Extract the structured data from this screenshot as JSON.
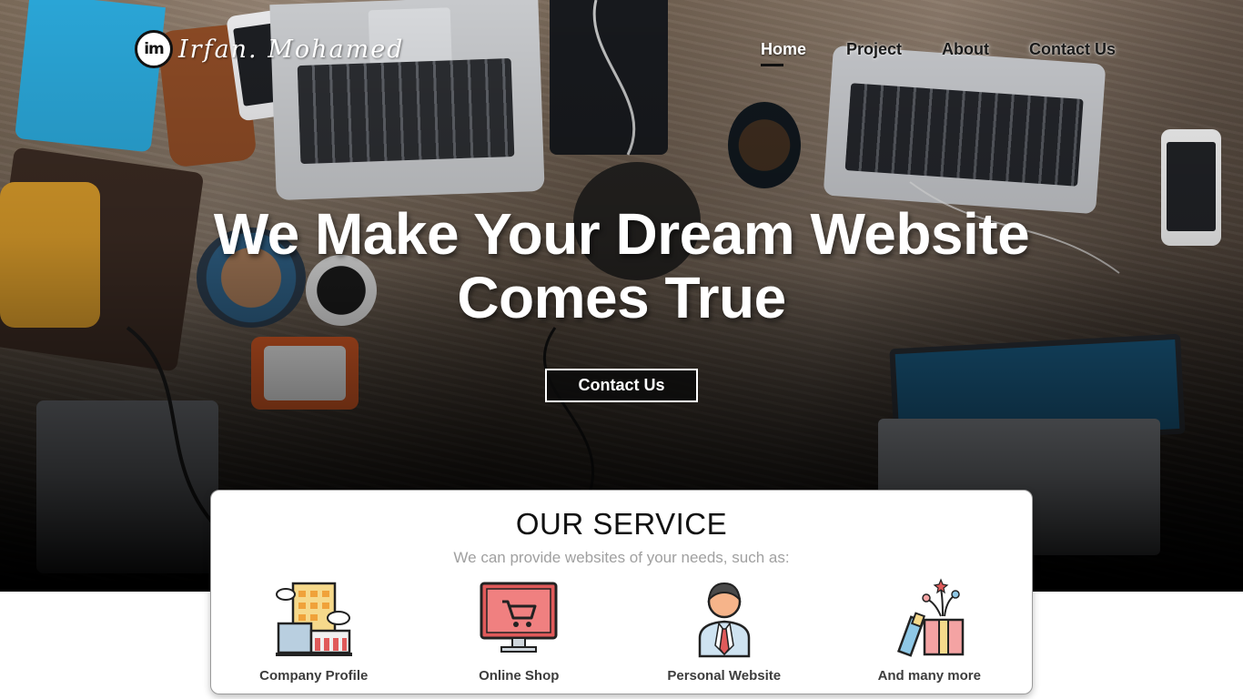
{
  "brand": {
    "logo_text": "im",
    "signature": "Irfan. Mohamed"
  },
  "nav": {
    "items": [
      {
        "label": "Home",
        "active": true
      },
      {
        "label": "Project",
        "active": false
      },
      {
        "label": "About",
        "active": false
      },
      {
        "label": "Contact Us",
        "active": false
      }
    ]
  },
  "hero": {
    "headline_line1": "We Make Your Dream Website",
    "headline_line2": "Comes True",
    "cta_label": "Contact Us"
  },
  "service": {
    "title": "OUR SERVICE",
    "subtitle": "We can provide websites of your needs, such as:",
    "items": [
      {
        "label": "Company Profile",
        "icon": "office-building-icon"
      },
      {
        "label": "Online Shop",
        "icon": "shopping-cart-monitor-icon"
      },
      {
        "label": "Personal Website",
        "icon": "person-icon"
      },
      {
        "label": "And many more",
        "icon": "gift-box-icon"
      }
    ]
  },
  "colors": {
    "text_dark": "#111111",
    "subtitle_gray": "#a0a0a0",
    "card_border": "#9a9a9a",
    "icon_red": "#e05a5a",
    "icon_yellow": "#f6d98b",
    "icon_blue": "#8fc8e6"
  }
}
